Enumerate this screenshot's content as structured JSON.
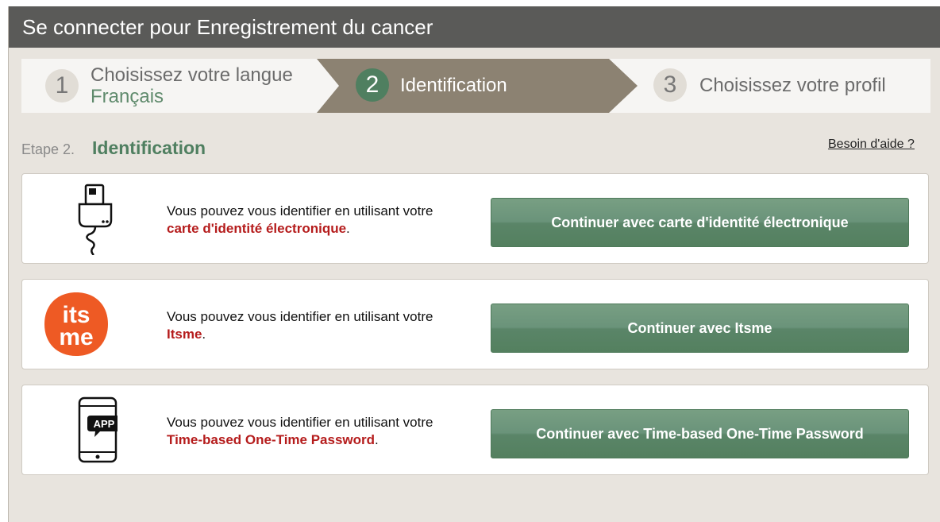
{
  "window": {
    "title": "Se connecter pour Enregistrement du cancer"
  },
  "stepper": {
    "steps": [
      {
        "number": "1",
        "title": "Choisissez votre langue",
        "subtitle": "Français"
      },
      {
        "number": "2",
        "title": "Identification"
      },
      {
        "number": "3",
        "title": "Choisissez votre profil"
      }
    ],
    "active_color": "#8c8272",
    "active_num_color": "#4f7f60"
  },
  "step_header": {
    "label": "Etape 2.",
    "title": "Identification",
    "help_link": "Besoin d'aide ?"
  },
  "methods": [
    {
      "icon": "card-reader-icon",
      "text_prefix": "Vous pouvez vous identifier en utilisant votre",
      "method_name": "carte d'identité électronique",
      "suffix": ".",
      "button_label": "Continuer avec carte d'identité électronique"
    },
    {
      "icon": "itsme-logo-icon",
      "icon_text_top": "its",
      "icon_text_bottom": "me",
      "text_prefix": "Vous pouvez vous identifier en utilisant votre",
      "method_name": "Itsme",
      "suffix": ".",
      "button_label": "Continuer avec Itsme"
    },
    {
      "icon": "phone-app-icon",
      "icon_text": "APP",
      "text_prefix": "Vous pouvez vous identifier en utilisant votre",
      "method_name": "Time-based One-Time Password",
      "suffix": ".",
      "button_label": "Continuer avec Time-based One-Time Password"
    }
  ],
  "colors": {
    "accent_green": "#4f7f60",
    "method_red": "#b51c1c",
    "itsme_orange": "#ee5a24"
  }
}
